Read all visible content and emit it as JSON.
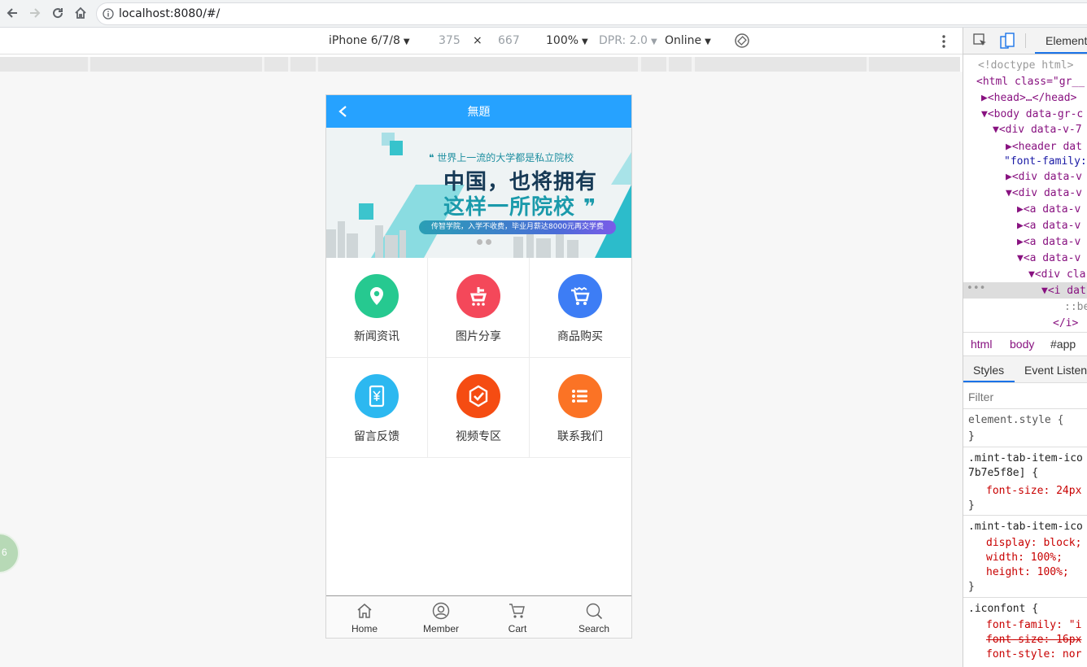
{
  "browser": {
    "url": "localhost:8080/#/"
  },
  "device_toolbar": {
    "device": "iPhone 6/7/8",
    "width": "375",
    "times": "×",
    "height": "667",
    "zoom": "100%",
    "dpr": "DPR: 2.0",
    "network": "Online"
  },
  "app": {
    "title": "無題",
    "banner": {
      "quote": "❝ 世界上一流的大学都是私立院校",
      "line1": "中国，也将拥有",
      "line2": "这样一所院校 ❞",
      "tagline": "传智学院，入学不收费，毕业月薪达8000元再交学费"
    },
    "grid": [
      {
        "label": "新闻资讯",
        "icon": "location-pin-icon",
        "color": "#26c990"
      },
      {
        "label": "图片分享",
        "icon": "photo-share-icon",
        "color": "#f4485a"
      },
      {
        "label": "商品购买",
        "icon": "shopping-cart-icon",
        "color": "#3d7df5"
      },
      {
        "label": "留言反馈",
        "icon": "phone-yen-icon",
        "color": "#2cb8f0"
      },
      {
        "label": "视频专区",
        "icon": "video-check-icon",
        "color": "#f54c12"
      },
      {
        "label": "联系我们",
        "icon": "list-icon",
        "color": "#fb7325"
      }
    ],
    "tabbar": [
      {
        "label": "Home",
        "icon": "home-icon"
      },
      {
        "label": "Member",
        "icon": "user-icon"
      },
      {
        "label": "Cart",
        "icon": "cart-icon"
      },
      {
        "label": "Search",
        "icon": "search-icon"
      }
    ]
  },
  "devtools": {
    "tab": "Element",
    "tree": [
      "<!doctype html>",
      "<html class=\"gr__",
      "▶<head>…</head>",
      "▼<body data-gr-c",
      "▼<div data-v-7",
      "▶<header dat",
      "\"font-family:",
      "▶<div data-v",
      "▼<div data-v",
      "▶<a data-v",
      "▶<a data-v",
      "▶<a data-v",
      "▼<a data-v",
      "▼<div cla",
      "▼<i dat",
      "::be",
      "</i>"
    ],
    "breadcrumb": [
      "html",
      "body",
      "#app"
    ],
    "styles_tab": "Styles",
    "event_tab": "Event Listen",
    "filter_placeholder": "Filter",
    "rules": [
      "element.style {",
      "}",
      ".mint-tab-item-ico",
      "7b7e5f8e] {",
      "font-size: 24px",
      "}",
      ".mint-tab-item-ico",
      "display: block;",
      "width: 100%;",
      "height: 100%;",
      "}",
      ".iconfont {",
      "font-family: \"i",
      "font-size: 16px",
      "font-style: nor"
    ]
  },
  "badge_text": "6"
}
